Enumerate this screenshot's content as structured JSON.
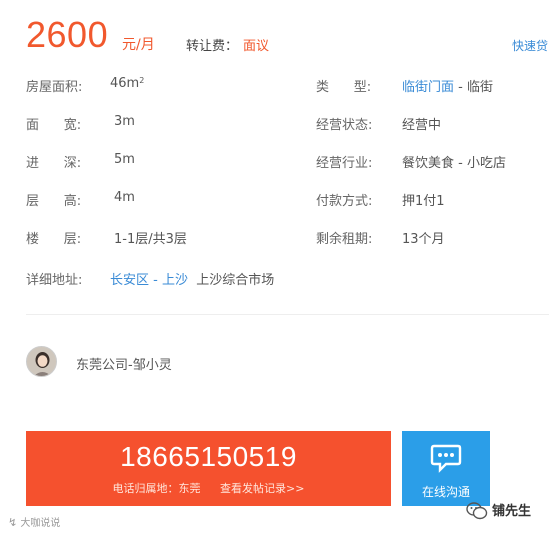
{
  "price": {
    "amount": "2600",
    "unit": "元/月",
    "fee_label": "转让费：",
    "fee_value": "面议",
    "loan_link": "快速贷"
  },
  "details": {
    "area": {
      "label": "房屋面积:",
      "value": "46m",
      "sup": "2"
    },
    "width": {
      "label": "面      宽:",
      "value": "3m"
    },
    "depth": {
      "label": "进      深:",
      "value": "5m"
    },
    "height": {
      "label": "层      高:",
      "value": "4m"
    },
    "floor": {
      "label": "楼      层:",
      "value": "1-1层/共3层"
    },
    "type": {
      "label": "类      型:",
      "value_link": "临街门面",
      "value_rest": " - 临街"
    },
    "status": {
      "label": "经营状态:",
      "value": "经营中"
    },
    "industry": {
      "label": "经营行业:",
      "value": "餐饮美食 - 小吃店"
    },
    "payment": {
      "label": "付款方式:",
      "value": "押1付1"
    },
    "lease": {
      "label": "剩余租期:",
      "value": "13个月"
    },
    "address": {
      "label": "详细地址:",
      "district": "长安区",
      "sep": " - ",
      "area": "上沙",
      "detail": "上沙综合市场"
    }
  },
  "contact": {
    "name": "东莞公司-邹小灵"
  },
  "phone": {
    "number": "18665150519",
    "location_label": "电话归属地：东莞",
    "history_link": "查看发帖记录>>"
  },
  "chat": {
    "label": "在线沟通"
  },
  "watermarks": {
    "left": "大咖说说",
    "right": "铺先生"
  },
  "colors": {
    "accent": "#f1582d",
    "link": "#3a8bd6",
    "phone_bg": "#f5512e",
    "chat_bg": "#2b9ee8"
  }
}
